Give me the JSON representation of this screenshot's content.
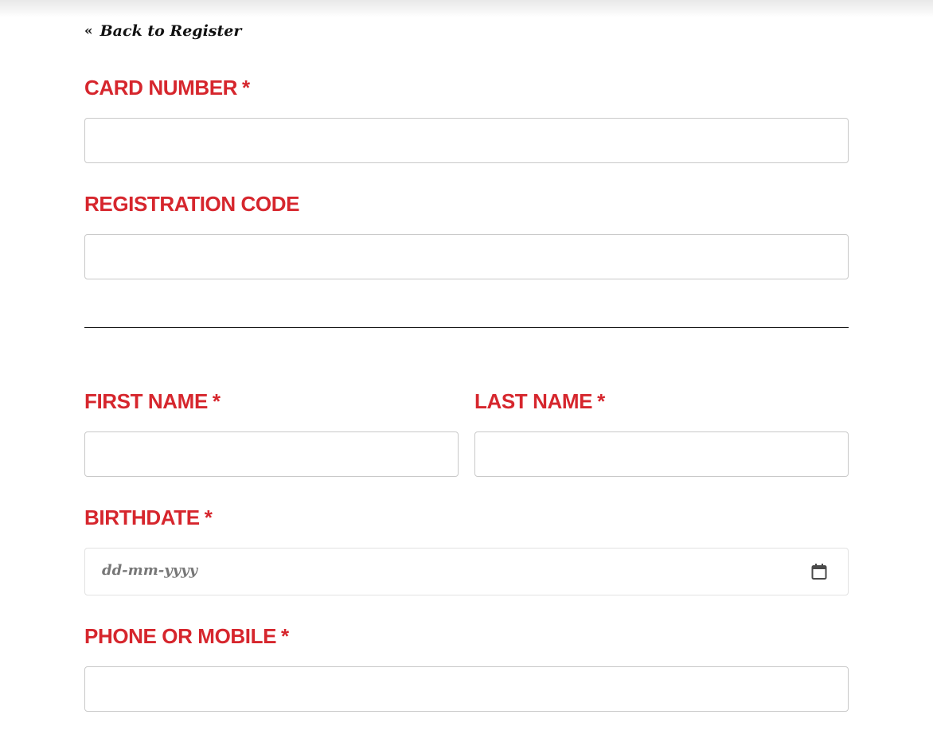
{
  "back_link": {
    "chevron": "«",
    "label": "Back to Register"
  },
  "form": {
    "card_number": {
      "label": "CARD NUMBER",
      "required_mark": "*",
      "value": ""
    },
    "registration_code": {
      "label": "REGISTRATION CODE",
      "value": ""
    },
    "first_name": {
      "label": "FIRST NAME",
      "required_mark": "*",
      "value": ""
    },
    "last_name": {
      "label": "LAST NAME",
      "required_mark": "*",
      "value": ""
    },
    "birthdate": {
      "label": "BIRTHDATE",
      "required_mark": "*",
      "placeholder": "dd-mm-yyyy",
      "icon": "calendar-icon"
    },
    "phone": {
      "label": "PHONE OR MOBILE",
      "required_mark": "*",
      "value": ""
    }
  },
  "colors": {
    "label": "#d6262d",
    "text": "#111111",
    "border": "#c9c9c9",
    "divider": "#111111"
  }
}
